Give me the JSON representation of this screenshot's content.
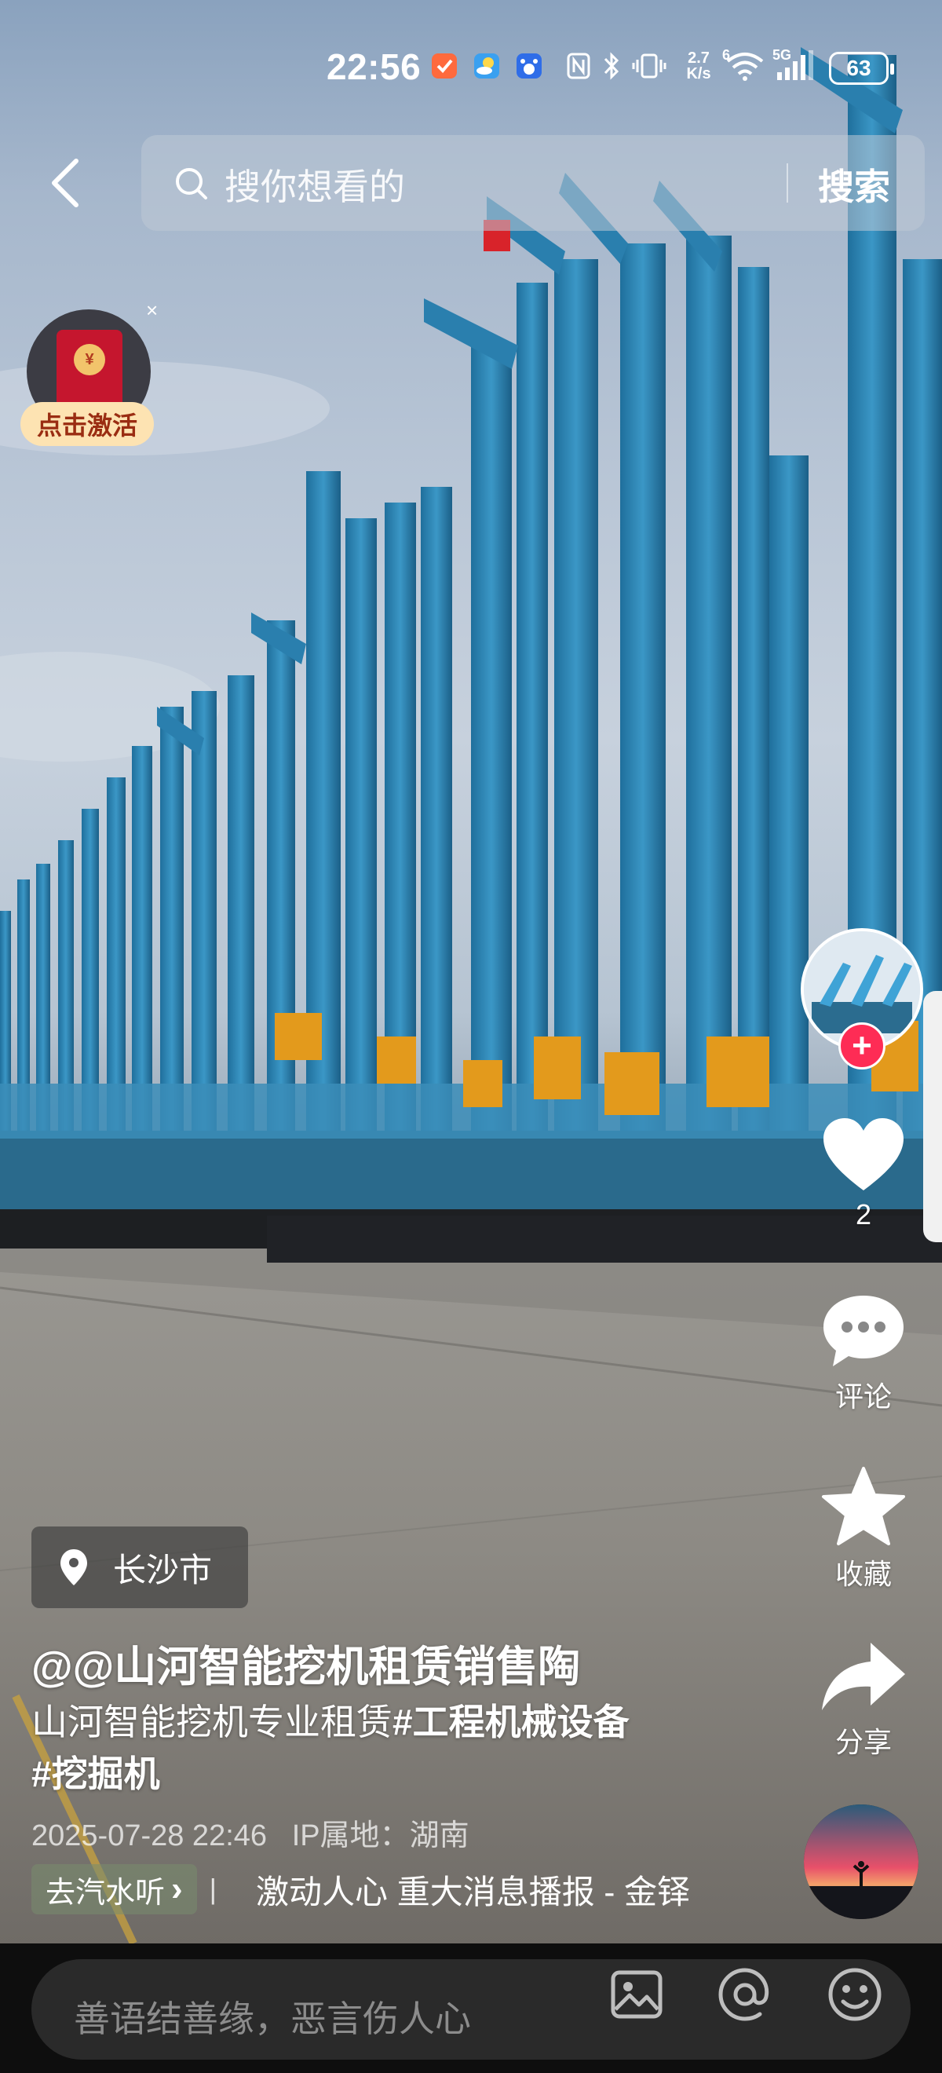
{
  "status_bar": {
    "time": "22:56",
    "net_speed_top": "2.7",
    "net_speed_bottom": "K/s",
    "signal_label": "5G",
    "alarm_badge": "6",
    "battery": "63"
  },
  "search": {
    "placeholder": "搜你想看的",
    "button_label": "搜索"
  },
  "red_packet": {
    "label": "点击激活",
    "coin_symbol": "¥",
    "close_symbol": "×"
  },
  "rail": {
    "like_count": "2",
    "comment_label": "评论",
    "favorite_label": "收藏",
    "share_label": "分享",
    "follow_symbol": "+"
  },
  "post": {
    "location": "长沙市",
    "author": "@@山河智能挖机租赁销售陶",
    "caption_text": "山河智能挖机专业租赁",
    "hashtag_1": "#工程机械设备",
    "hashtag_2": "#挖掘机",
    "datetime": "2025-07-28 22:46",
    "ip_location": "IP属地：湖南",
    "music_chip": "去汽水听",
    "music_chip_arrow": "›",
    "music_separator": "|",
    "music_title": "激动人心 重大消息播报 - 金铎"
  },
  "comment_bar": {
    "placeholder": "善语结善缘，恶言伤人心"
  },
  "colors": {
    "accent_red": "#fe2c55",
    "rig_blue": "#2f86b5",
    "rig_orange": "#e39a1c"
  },
  "icons": [
    "back-icon",
    "search-icon",
    "nfc-icon",
    "bluetooth-icon",
    "vibrate-icon",
    "wifi-icon",
    "signal-icon",
    "battery-icon",
    "heart-icon",
    "comment-icon",
    "star-icon",
    "share-icon",
    "location-pin-icon",
    "image-icon",
    "at-icon",
    "emoji-icon"
  ]
}
